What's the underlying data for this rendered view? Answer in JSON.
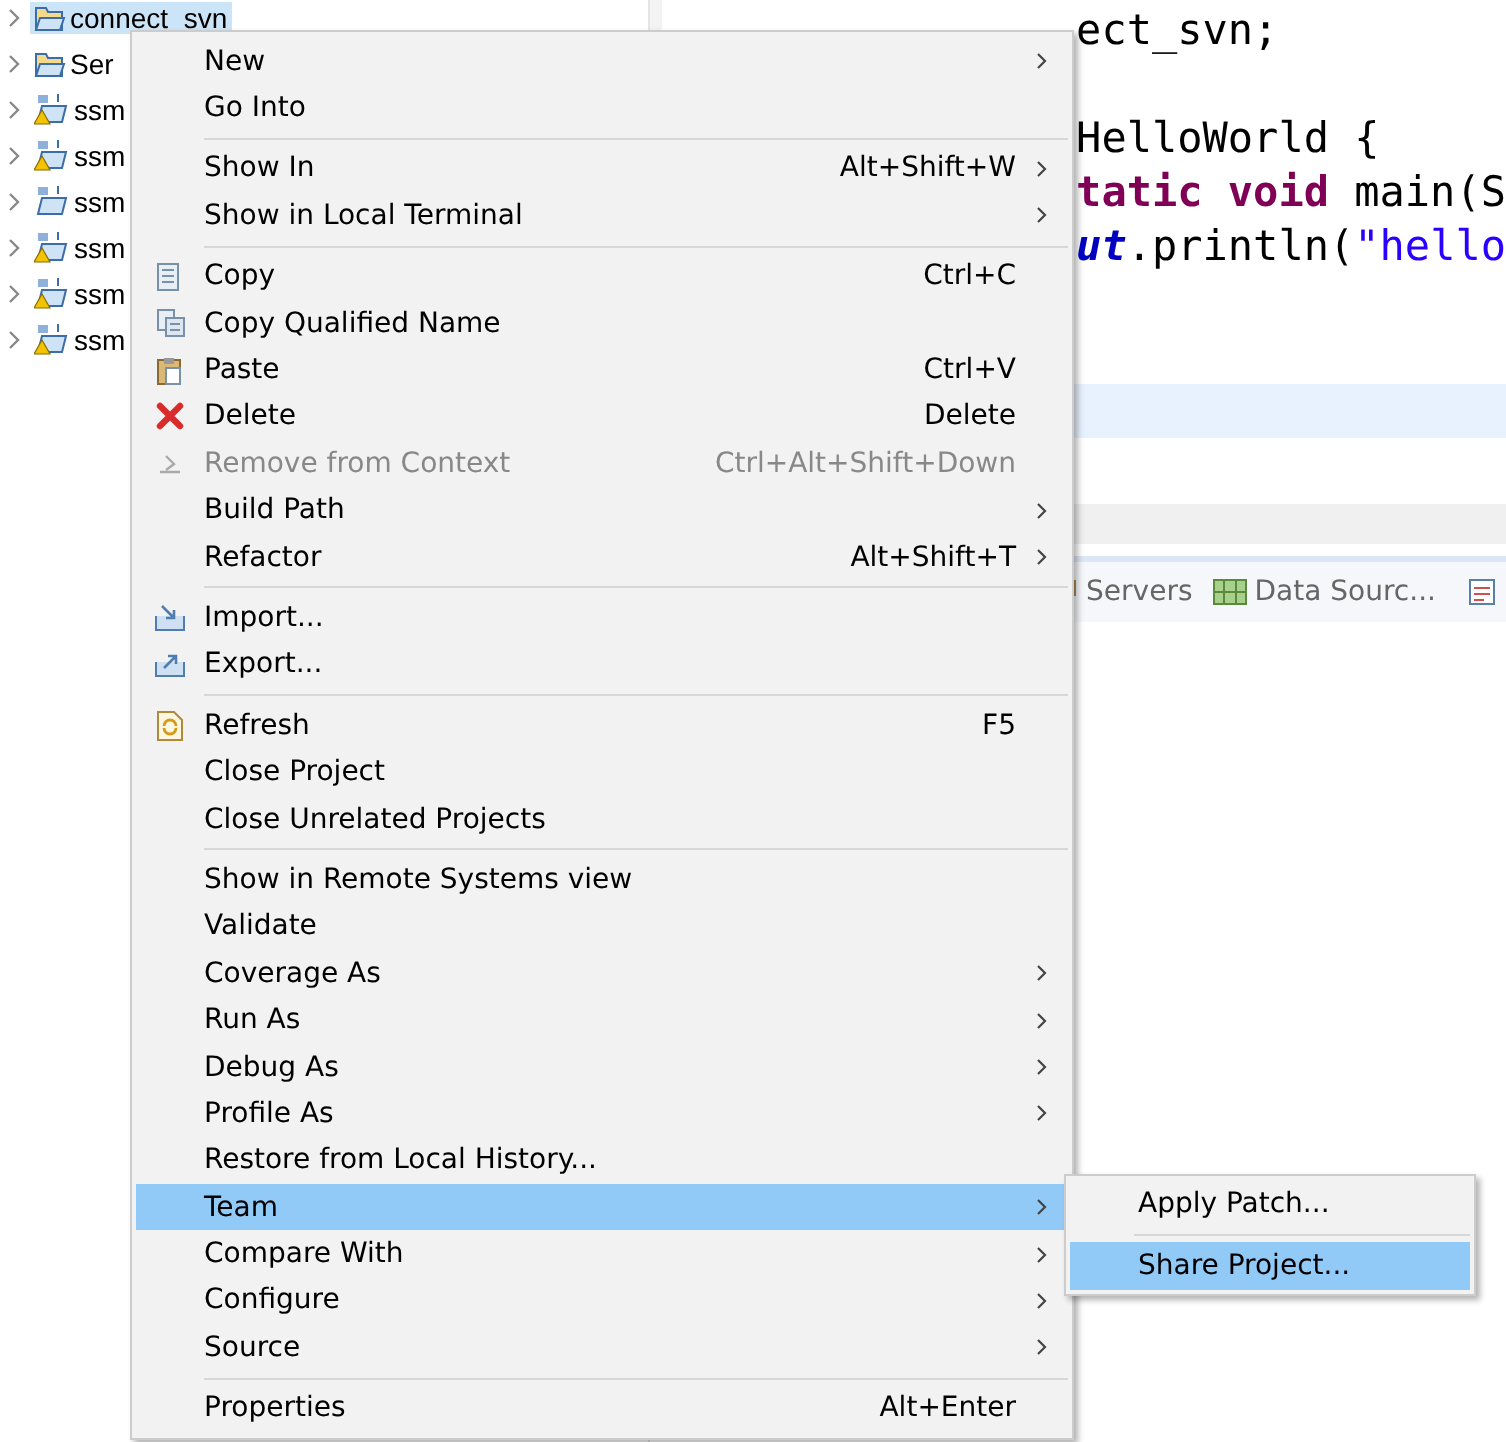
{
  "project_tree": [
    {
      "label": "connect_svn",
      "kind": "folder",
      "selected": true
    },
    {
      "label": "Ser",
      "kind": "folder",
      "selected": false
    },
    {
      "label": "ssm",
      "kind": "maven-warning",
      "selected": false
    },
    {
      "label": "ssm",
      "kind": "maven-warning",
      "selected": false
    },
    {
      "label": "ssm",
      "kind": "maven",
      "selected": false
    },
    {
      "label": "ssm",
      "kind": "maven-warning",
      "selected": false
    },
    {
      "label": "ssm",
      "kind": "maven-warning",
      "selected": false
    },
    {
      "label": "ssm",
      "kind": "maven-warning",
      "selected": false
    }
  ],
  "editor": {
    "lines": [
      {
        "segments": [
          {
            "text": "ect_svn;",
            "kind": "plain"
          }
        ]
      },
      {
        "segments": [
          {
            "text": "HelloWorld {",
            "kind": "plain"
          }
        ]
      },
      {
        "segments": [
          {
            "text": "tatic void",
            "kind": "keyword"
          },
          {
            "text": " main(S",
            "kind": "plain"
          }
        ]
      },
      {
        "segments": [
          {
            "text": "ut",
            "kind": "field"
          },
          {
            "text": ".println(",
            "kind": "plain"
          },
          {
            "text": "\"hello",
            "kind": "string"
          }
        ]
      }
    ],
    "view_tabs": [
      {
        "label": "Servers"
      },
      {
        "label": "Data Sourc..."
      }
    ]
  },
  "context_menu": {
    "groups": [
      [
        {
          "label": "New",
          "kind": "plain",
          "submenu": true,
          "disabled": false,
          "selected": false
        },
        {
          "label": "Go Into",
          "kind": "plain",
          "submenu": false,
          "disabled": false,
          "selected": false
        }
      ],
      [
        {
          "label": "Show In",
          "shortcut": "Alt+Shift+W",
          "kind": "plain",
          "submenu": true,
          "disabled": false,
          "selected": false
        },
        {
          "label": "Show in Local Terminal",
          "kind": "plain",
          "submenu": true,
          "disabled": false,
          "selected": false
        }
      ],
      [
        {
          "label": "Copy",
          "shortcut": "Ctrl+C",
          "kind": "copy",
          "submenu": false,
          "disabled": false,
          "selected": false
        },
        {
          "label": "Copy Qualified Name",
          "kind": "copy-qualified",
          "submenu": false,
          "disabled": false,
          "selected": false
        },
        {
          "label": "Paste",
          "shortcut": "Ctrl+V",
          "kind": "paste",
          "submenu": false,
          "disabled": false,
          "selected": false
        },
        {
          "label": "Delete",
          "shortcut": "Delete",
          "kind": "delete",
          "submenu": false,
          "disabled": false,
          "selected": false
        },
        {
          "label": "Remove from Context",
          "shortcut": "Ctrl+Alt+Shift+Down",
          "kind": "remove",
          "submenu": false,
          "disabled": true,
          "selected": false
        },
        {
          "label": "Build Path",
          "kind": "plain",
          "submenu": true,
          "disabled": false,
          "selected": false
        },
        {
          "label": "Refactor",
          "shortcut": "Alt+Shift+T",
          "kind": "plain",
          "submenu": true,
          "disabled": false,
          "selected": false
        }
      ],
      [
        {
          "label": "Import...",
          "kind": "import",
          "submenu": false,
          "disabled": false,
          "selected": false
        },
        {
          "label": "Export...",
          "kind": "export",
          "submenu": false,
          "disabled": false,
          "selected": false
        }
      ],
      [
        {
          "label": "Refresh",
          "shortcut": "F5",
          "kind": "refresh",
          "submenu": false,
          "disabled": false,
          "selected": false
        },
        {
          "label": "Close Project",
          "kind": "plain",
          "submenu": false,
          "disabled": false,
          "selected": false
        },
        {
          "label": "Close Unrelated Projects",
          "kind": "plain",
          "submenu": false,
          "disabled": false,
          "selected": false
        }
      ],
      [
        {
          "label": "Show in Remote Systems view",
          "kind": "plain",
          "submenu": false,
          "disabled": false,
          "selected": false
        },
        {
          "label": "Validate",
          "kind": "plain",
          "submenu": false,
          "disabled": false,
          "selected": false
        },
        {
          "label": "Coverage As",
          "kind": "plain",
          "submenu": true,
          "disabled": false,
          "selected": false
        },
        {
          "label": "Run As",
          "kind": "plain",
          "submenu": true,
          "disabled": false,
          "selected": false
        },
        {
          "label": "Debug As",
          "kind": "plain",
          "submenu": true,
          "disabled": false,
          "selected": false
        },
        {
          "label": "Profile As",
          "kind": "plain",
          "submenu": true,
          "disabled": false,
          "selected": false
        },
        {
          "label": "Restore from Local History...",
          "kind": "plain",
          "submenu": false,
          "disabled": false,
          "selected": false
        },
        {
          "label": "Team",
          "kind": "plain",
          "submenu": true,
          "disabled": false,
          "selected": true
        },
        {
          "label": "Compare With",
          "kind": "plain",
          "submenu": true,
          "disabled": false,
          "selected": false
        },
        {
          "label": "Configure",
          "kind": "plain",
          "submenu": true,
          "disabled": false,
          "selected": false
        },
        {
          "label": "Source",
          "kind": "plain",
          "submenu": true,
          "disabled": false,
          "selected": false
        }
      ],
      [
        {
          "label": "Properties",
          "shortcut": "Alt+Enter",
          "kind": "plain",
          "submenu": false,
          "disabled": false,
          "selected": false
        }
      ]
    ]
  },
  "submenu": {
    "groups": [
      [
        {
          "label": "Apply Patch...",
          "selected": false
        }
      ],
      [
        {
          "label": "Share Project...",
          "selected": true
        }
      ]
    ]
  }
}
